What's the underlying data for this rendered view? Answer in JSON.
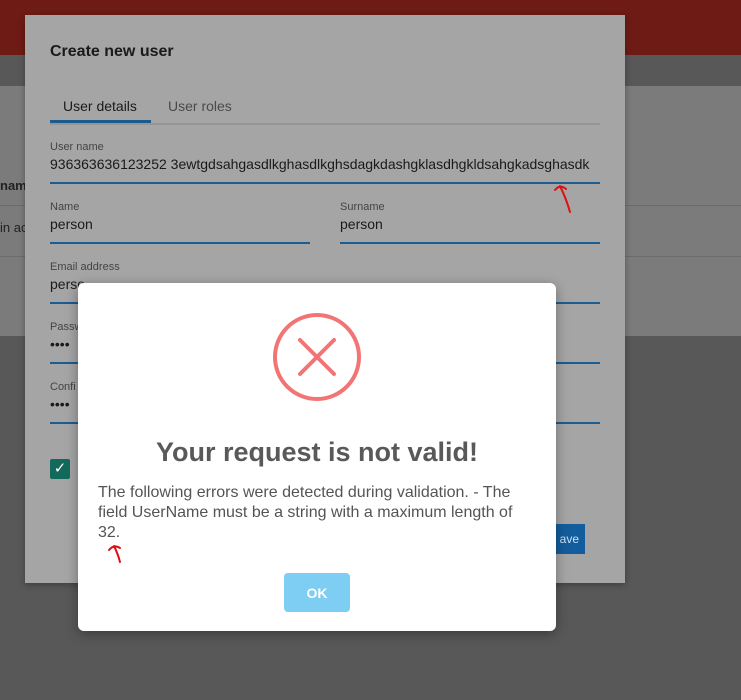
{
  "background": {
    "text_row_1": "name",
    "text_row_2": "in ac"
  },
  "create_user_modal": {
    "title": "Create new user",
    "tabs": [
      {
        "label": "User details",
        "active": true
      },
      {
        "label": "User roles",
        "active": false
      }
    ],
    "fields": {
      "username": {
        "label": "User name",
        "value": "936363636123252 3ewtgdsahgasdlkghasdlkghsdagkdashgklasdhgkldsahgkadsghasdk"
      },
      "name": {
        "label": "Name",
        "value": "person"
      },
      "surname": {
        "label": "Surname",
        "value": "person"
      },
      "email": {
        "label": "Email address",
        "value": "perso"
      },
      "password": {
        "label": "Passw",
        "value": "••••"
      },
      "confirm": {
        "label": "Confi",
        "value": "••••"
      }
    },
    "checkbox_checked": true,
    "save_label": "ave"
  },
  "error_dialog": {
    "title": "Your request is not valid!",
    "message": "The following errors were detected during validation. - The field UserName must be a string with a maximum length of 32.",
    "ok_label": "OK",
    "icon": "error-x-icon"
  },
  "colors": {
    "error_icon": "#f27474",
    "ok_button": "#7ecdf3",
    "field_underline": "#1a5d93"
  }
}
